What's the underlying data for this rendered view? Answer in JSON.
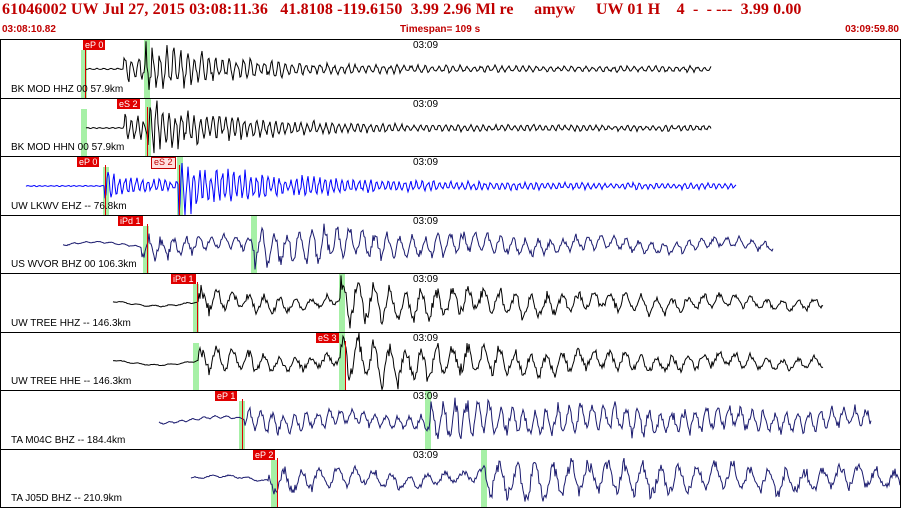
{
  "header": {
    "title": "61046002 UW Jul 27, 2015 03:08:11.36   41.8108 -119.6150  3.99 2.96 Ml re     amyw     UW 01 H    4  -  - ---  3.99 0.00"
  },
  "timebar": {
    "start": "03:08:10.82",
    "span": "Timespan= 109 s",
    "end": "03:09:59.80"
  },
  "traces": [
    {
      "label": "BK MOD HHZ 00 57.9km",
      "minute": "03:09",
      "color": "#000000",
      "picks": [
        {
          "text": "eP 0",
          "type": "solid"
        }
      ],
      "wave": {
        "start": 85,
        "end": 710,
        "onset": 0.06,
        "s": 0.11,
        "amp": 0.9,
        "freq": 0.9,
        "decay": 0.012,
        "noise": 0.04
      }
    },
    {
      "label": "BK MOD HHN 00 57.9km",
      "minute": "03:09",
      "color": "#000000",
      "picks": [
        {
          "text": "eS 2",
          "type": "solid"
        }
      ],
      "wave": {
        "start": 85,
        "end": 710,
        "onset": 0.06,
        "s": 0.1,
        "amp": 0.9,
        "freq": 1.0,
        "decay": 0.012,
        "noise": 0.03
      }
    },
    {
      "label": "UW LKWV EHZ -- 76.8km",
      "minute": "03:09",
      "color": "#0000ff",
      "picks": [
        {
          "text": "eP 0",
          "type": "solid"
        },
        {
          "text": "eS 2",
          "type": "pale"
        }
      ],
      "wave": {
        "start": 25,
        "end": 735,
        "onset": 0.11,
        "s": 0.22,
        "amp": 0.9,
        "freq": 1.1,
        "decay": 0.01,
        "noise": 0.03
      }
    },
    {
      "label": "US WVOR BHZ 00 106.3km",
      "minute": "03:09",
      "color": "#1a1a6e",
      "picks": [
        {
          "text": "iPd 1",
          "type": "solid"
        }
      ],
      "wave": {
        "start": 62,
        "end": 772,
        "onset": 0.11,
        "s": 0.27,
        "amp": 0.7,
        "freq": 0.5,
        "decay": 0.004,
        "noise": 0.05
      }
    },
    {
      "label": "UW TREE HHZ -- 146.3km",
      "minute": "03:09",
      "color": "#000000",
      "picks": [
        {
          "text": "iPd 1",
          "type": "solid"
        }
      ],
      "wave": {
        "start": 112,
        "end": 822,
        "onset": 0.12,
        "s": 0.33,
        "amp": 0.8,
        "freq": 0.4,
        "decay": 0.004,
        "noise": 0.05
      }
    },
    {
      "label": "UW TREE HHE -- 146.3km",
      "minute": "03:09",
      "color": "#000000",
      "picks": [
        {
          "text": "eS 3",
          "type": "solid"
        }
      ],
      "wave": {
        "start": 112,
        "end": 822,
        "onset": 0.12,
        "s": 0.33,
        "amp": 0.85,
        "freq": 0.4,
        "decay": 0.004,
        "noise": 0.04
      }
    },
    {
      "label": "TA M04C BHZ -- 184.4km",
      "minute": "03:09",
      "color": "#1a1a6e",
      "picks": [
        {
          "text": "eP 1",
          "type": "solid"
        }
      ],
      "wave": {
        "start": 158,
        "end": 870,
        "onset": 0.12,
        "s": 0.38,
        "amp": 0.65,
        "freq": 0.55,
        "decay": 0.002,
        "noise": 0.08
      }
    },
    {
      "label": "TA J05D BHZ -- 210.9km",
      "minute": "03:09",
      "color": "#1a1a6e",
      "picks": [
        {
          "text": "eP 2",
          "type": "solid"
        }
      ],
      "wave": {
        "start": 190,
        "end": 899,
        "onset": 0.11,
        "s": 0.41,
        "amp": 0.75,
        "freq": 0.35,
        "decay": 0.002,
        "noise": 0.08
      }
    }
  ]
}
